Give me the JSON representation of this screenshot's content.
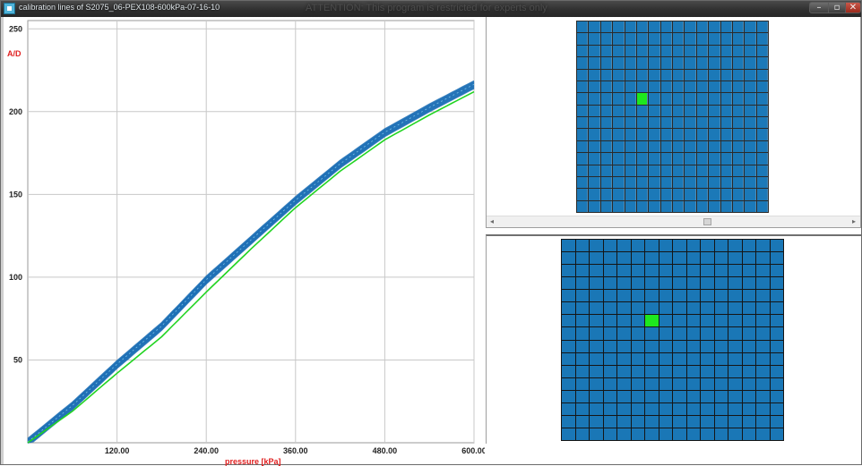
{
  "window": {
    "title": "calibration lines of S2075_06-PEX108-600kPa-07-16-10",
    "warning": "ATTENTION: This program is restricted for experts only",
    "min_glyph": "–",
    "max_glyph": "▫",
    "close_glyph": "✕"
  },
  "chart_data": {
    "type": "line",
    "ylabel": "A/D",
    "xlabel": "pressure [kPa]",
    "xlim": [
      0,
      600
    ],
    "ylim": [
      0,
      255
    ],
    "x_ticks": [
      "120.00",
      "240.00",
      "360.00",
      "480.00",
      "600.00"
    ],
    "y_ticks": [
      "50",
      "100",
      "150",
      "200",
      "250"
    ],
    "grid": true,
    "series": [
      {
        "color": "#1c6fb5",
        "x": [
          0,
          60,
          120,
          180,
          240,
          300,
          360,
          420,
          480,
          540,
          600
        ],
        "values": [
          0,
          22,
          47,
          70,
          98,
          122,
          146,
          168,
          187,
          202,
          216
        ]
      },
      {
        "color": "#22d422",
        "x": [
          0,
          60,
          120,
          180,
          240,
          300,
          360,
          420,
          480,
          540,
          600
        ],
        "values": [
          0,
          19,
          42,
          64,
          91,
          117,
          142,
          164,
          183,
          198,
          212
        ]
      }
    ],
    "colors": {
      "band": "#1c6fb5",
      "fit": "#22d422",
      "axis_name": "#e02020"
    }
  },
  "sensor_grid_top": {
    "rows": 16,
    "cols": 16,
    "active_cell": [
      6,
      5
    ],
    "color": "#1b79b8",
    "active_color": "#1ee81e"
  },
  "sensor_grid_bottom": {
    "rows": 16,
    "cols": 16,
    "active_cell": [
      6,
      6
    ],
    "color": "#1a77b6",
    "active_color": "#1ee81e"
  },
  "scrollbar": {
    "left_arrow": "◂",
    "right_arrow": "▸"
  }
}
